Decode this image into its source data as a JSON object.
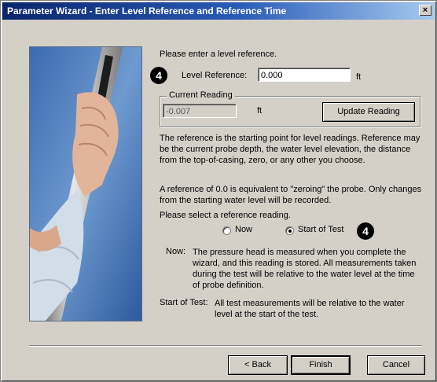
{
  "window": {
    "title": "Parameter Wizard - Enter Level Reference and Reference Time",
    "close_glyph": "×"
  },
  "image": {
    "icon": "probe-in-hand-photo"
  },
  "level_reference": {
    "prompt": "Please enter a level reference.",
    "badge": "4",
    "label": "Level Reference:",
    "value": "0.000",
    "unit": "ft"
  },
  "current_reading": {
    "legend": "Current Reading",
    "value": "-0.007",
    "unit": "ft",
    "update_button": "Update Reading"
  },
  "explanation": {
    "para1": "The reference is the starting point for level readings. Reference may be the current probe depth, the water level elevation, the distance from the top-of-casing, zero, or any other you choose.",
    "para2": "A reference of 0.0 is equivalent to \"zeroing\" the probe.  Only changes from the starting water level will be recorded."
  },
  "reference_reading": {
    "prompt": "Please select a reference reading.",
    "option_now": "Now",
    "option_start": "Start of Test",
    "selected": "Start of Test",
    "badge": "4"
  },
  "notes": {
    "now_label": "Now:",
    "now_text": "The pressure head is measured when you complete the wizard, and this reading is stored.  All measurements taken during the test will be relative to the water level at the time of probe definition.",
    "start_label": "Start of Test:",
    "start_text": "All test measurements will be relative to the water level at the start of the test."
  },
  "buttons": {
    "back": "< Back",
    "finish": "Finish",
    "cancel": "Cancel"
  }
}
